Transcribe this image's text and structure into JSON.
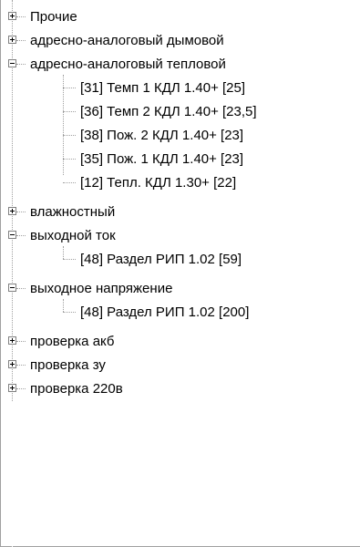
{
  "tree": {
    "nodes": [
      {
        "label": "Прочие",
        "expanded": false
      },
      {
        "label": "адресно-аналоговый дымовой",
        "expanded": false
      },
      {
        "label": "адресно-аналоговый тепловой",
        "expanded": true,
        "children": [
          "[31] Темп 1 КДЛ 1.40+ [25]",
          "[36] Темп 2 КДЛ 1.40+ [23,5]",
          "[38] Пож. 2 КДЛ 1.40+ [23]",
          "[35] Пож. 1 КДЛ 1.40+ [23]",
          "[12] Тепл. КДЛ 1.30+ [22]"
        ]
      },
      {
        "label": "влажностный",
        "expanded": false
      },
      {
        "label": "выходной ток",
        "expanded": true,
        "children": [
          "[48] Раздел РИП 1.02 [59]"
        ]
      },
      {
        "label": "выходное напряжение",
        "expanded": true,
        "children": [
          "[48] Раздел РИП 1.02 [200]"
        ]
      },
      {
        "label": "проверка акб",
        "expanded": false
      },
      {
        "label": "проверка зу",
        "expanded": false
      },
      {
        "label": "проверка 220в",
        "expanded": false
      }
    ]
  }
}
